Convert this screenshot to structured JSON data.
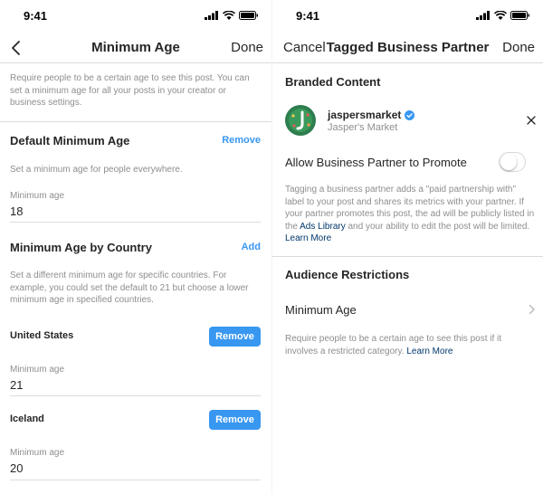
{
  "left": {
    "status_time": "9:41",
    "nav": {
      "title": "Minimum Age",
      "done": "Done"
    },
    "intro": "Require people to be a certain age to see this post. You can set a minimum age for all your posts in your creator or business settings.",
    "default": {
      "title": "Default Minimum Age",
      "action": "Remove",
      "desc": "Set a minimum age for people everywhere.",
      "field_label": "Minimum age",
      "field_value": "18"
    },
    "by_country": {
      "title": "Minimum Age by Country",
      "action": "Add",
      "desc": "Set a different minimum age for specific countries. For example, you could set the default to 21 but choose a lower minimum age in specified countries."
    },
    "countries": [
      {
        "name": "United States",
        "button": "Remove",
        "field_label": "Minimum age",
        "field_value": "21"
      },
      {
        "name": "Iceland",
        "button": "Remove",
        "field_label": "Minimum age",
        "field_value": "20"
      }
    ]
  },
  "right": {
    "status_time": "9:41",
    "nav": {
      "cancel": "Cancel",
      "title": "Tagged Business Partner",
      "done": "Done"
    },
    "branded": {
      "title": "Branded Content",
      "username": "jaspersmarket",
      "display_name": "Jasper's Market",
      "toggle_label": "Allow Business Partner to Promote",
      "toggle_on": false,
      "info_part1": "Tagging a business partner adds a \"paid partnership with\" label to your post and shares its metrics with your partner. If your partner promotes this post, the ad will be publicly listed in the ",
      "ads_library": "Ads Library",
      "info_part2": " and your ability to edit the post will be limited. ",
      "learn_more": "Learn More"
    },
    "audience": {
      "title": "Audience Restrictions",
      "row_label": "Minimum Age",
      "desc": "Require people to be a certain age to see this post if it involves a restricted category. ",
      "learn_more": "Learn More"
    }
  },
  "colors": {
    "accent": "#3897f0",
    "link_dark": "#00376b",
    "verified": "#3897f0",
    "muted": "#8e8e8e"
  },
  "icons": [
    "back-chevron-icon",
    "signal-icon",
    "wifi-icon",
    "battery-icon",
    "verified-badge-icon",
    "close-icon",
    "chevron-right-icon",
    "avatar-logo"
  ]
}
